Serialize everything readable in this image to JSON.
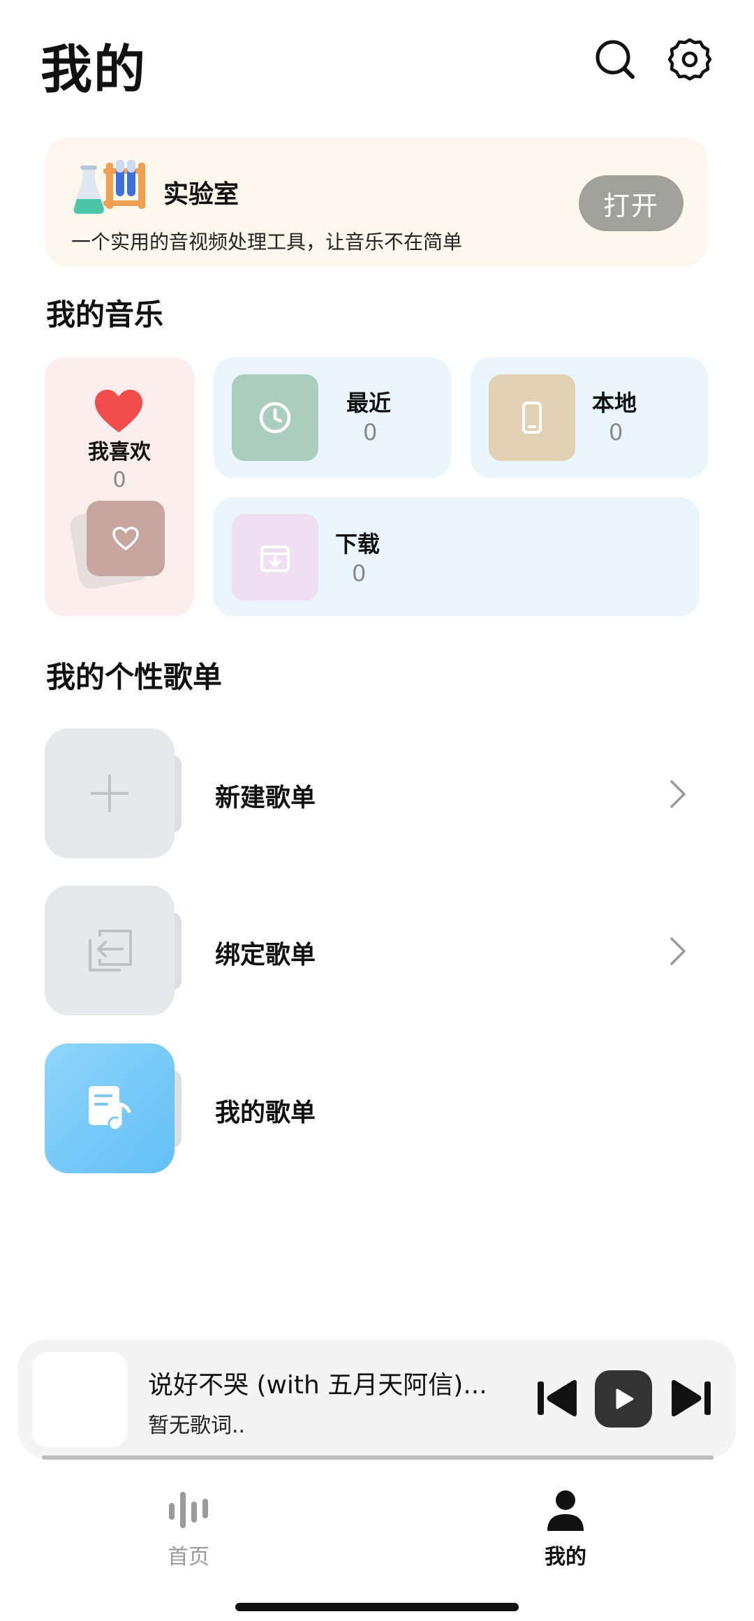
{
  "header": {
    "title": "我的",
    "search_icon": "search-icon",
    "settings_icon": "gear-icon"
  },
  "lab": {
    "title": "实验室",
    "description": "一个实用的音视频处理工具，让音乐不在简单",
    "button": "打开",
    "icon": "lab-flask-icon"
  },
  "my_music": {
    "section_title": "我的音乐",
    "favorites": {
      "label": "我喜欢",
      "count": "0",
      "color": "#f24c4c"
    },
    "recent": {
      "label": "最近",
      "count": "0",
      "color": "#aacdbf"
    },
    "local": {
      "label": "本地",
      "count": "0",
      "color": "#e2d2b3"
    },
    "download": {
      "label": "下载",
      "count": "0",
      "color": "#f0def3"
    }
  },
  "playlists": {
    "section_title": "我的个性歌单",
    "items": [
      {
        "label": "新建歌单",
        "icon": "plus-icon",
        "has_chevron": true
      },
      {
        "label": "绑定歌单",
        "icon": "import-icon",
        "has_chevron": true
      },
      {
        "label": "我的歌单",
        "icon": "music-note-doc-icon",
        "has_chevron": false
      }
    ]
  },
  "player": {
    "title": "说好不哭 (with 五月天阿信)...",
    "subtitle": "暂无歌词..",
    "progress": 0.0
  },
  "tabbar": {
    "home": "首页",
    "mine": "我的",
    "active": "mine"
  }
}
